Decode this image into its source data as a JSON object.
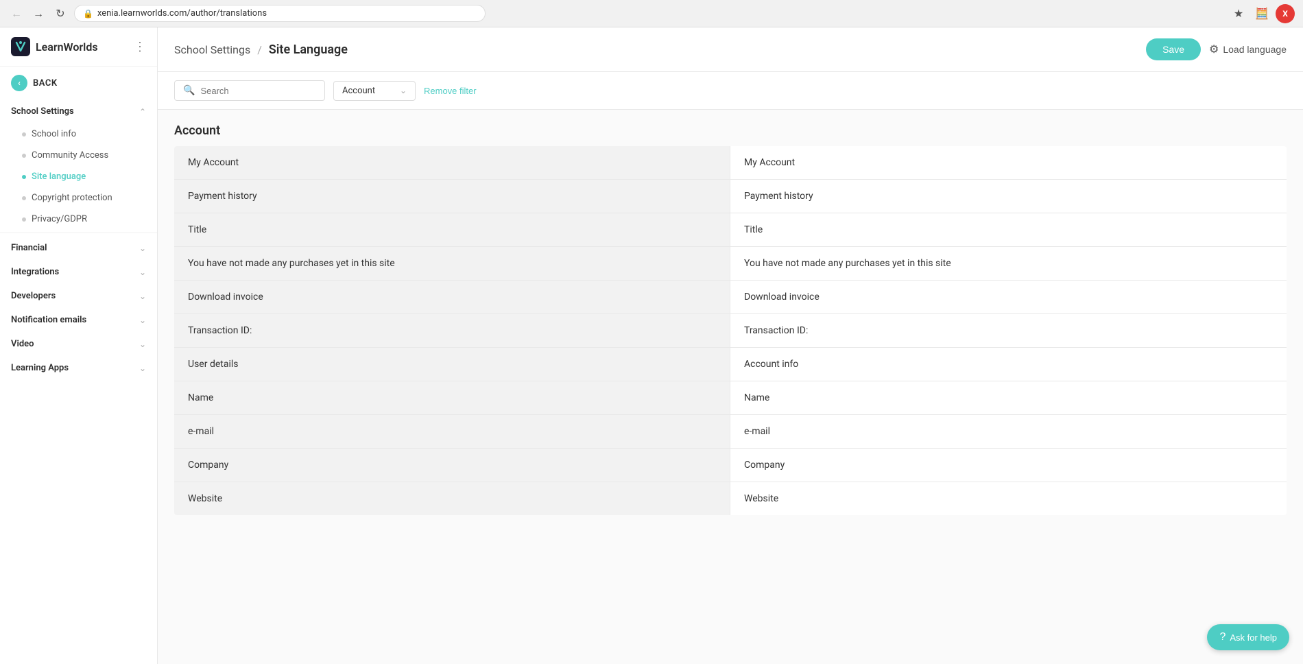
{
  "browser": {
    "url": "xenia.learnworlds.com/author/translations",
    "avatar_label": "X"
  },
  "sidebar": {
    "logo_text": "LearnWorlds",
    "back_label": "BACK",
    "school_settings_label": "School Settings",
    "school_info_label": "School info",
    "community_access_label": "Community Access",
    "site_language_label": "Site language",
    "copyright_protection_label": "Copyright protection",
    "privacy_gdpr_label": "Privacy/GDPR",
    "financial_label": "Financial",
    "integrations_label": "Integrations",
    "developers_label": "Developers",
    "notification_emails_label": "Notification emails",
    "video_label": "Video",
    "learning_apps_label": "Learning Apps"
  },
  "header": {
    "breadcrumb": "School Settings",
    "separator": "/",
    "title": "Site Language",
    "save_label": "Save",
    "load_language_label": "Load language"
  },
  "filter": {
    "search_placeholder": "Search",
    "filter_value": "Account",
    "remove_filter_label": "Remove filter"
  },
  "content": {
    "section_title": "Account",
    "rows": [
      {
        "original": "My Account",
        "translation": "My Account"
      },
      {
        "original": "Payment history",
        "translation": "Payment history"
      },
      {
        "original": "Title",
        "translation": "Title"
      },
      {
        "original": "You have not made any purchases yet in this site",
        "translation": "You have not made any purchases yet in this site"
      },
      {
        "original": "Download invoice",
        "translation": "Download invoice"
      },
      {
        "original": "Transaction ID:",
        "translation": "Transaction ID:"
      },
      {
        "original": "User details",
        "translation": "Account info"
      },
      {
        "original": "Name",
        "translation": "Name"
      },
      {
        "original": "e-mail",
        "translation": "e-mail"
      },
      {
        "original": "Company",
        "translation": "Company"
      },
      {
        "original": "Website",
        "translation": "Website"
      }
    ]
  },
  "help": {
    "label": "Ask for help"
  }
}
